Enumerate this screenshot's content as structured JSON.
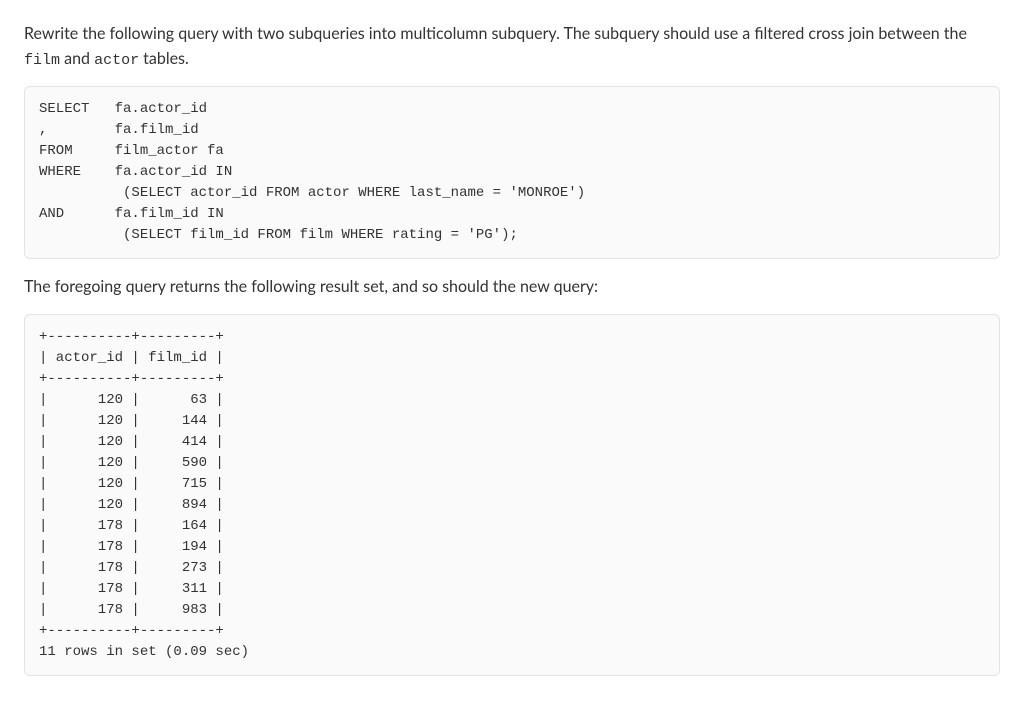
{
  "intro": {
    "part1": "Rewrite the following query with two subqueries into multicolumn subquery. The subquery should use a filtered cross join between the ",
    "code1": "film",
    "part2": " and ",
    "code2": "actor",
    "part3": " tables."
  },
  "code_block_1": "SELECT   fa.actor_id\n,        fa.film_id\nFROM     film_actor fa\nWHERE    fa.actor_id IN\n          (SELECT actor_id FROM actor WHERE last_name = 'MONROE')\nAND      fa.film_id IN\n          (SELECT film_id FROM film WHERE rating = 'PG');",
  "middle_text": "The foregoing query returns the following result set, and so should the new query:",
  "code_block_2": "+----------+---------+\n| actor_id | film_id |\n+----------+---------+\n|      120 |      63 |\n|      120 |     144 |\n|      120 |     414 |\n|      120 |     590 |\n|      120 |     715 |\n|      120 |     894 |\n|      178 |     164 |\n|      178 |     194 |\n|      178 |     273 |\n|      178 |     311 |\n|      178 |     983 |\n+----------+---------+\n11 rows in set (0.09 sec)",
  "chart_data": {
    "type": "table",
    "columns": [
      "actor_id",
      "film_id"
    ],
    "rows": [
      [
        120,
        63
      ],
      [
        120,
        144
      ],
      [
        120,
        414
      ],
      [
        120,
        590
      ],
      [
        120,
        715
      ],
      [
        120,
        894
      ],
      [
        178,
        164
      ],
      [
        178,
        194
      ],
      [
        178,
        273
      ],
      [
        178,
        311
      ],
      [
        178,
        983
      ]
    ],
    "footer": "11 rows in set (0.09 sec)"
  }
}
